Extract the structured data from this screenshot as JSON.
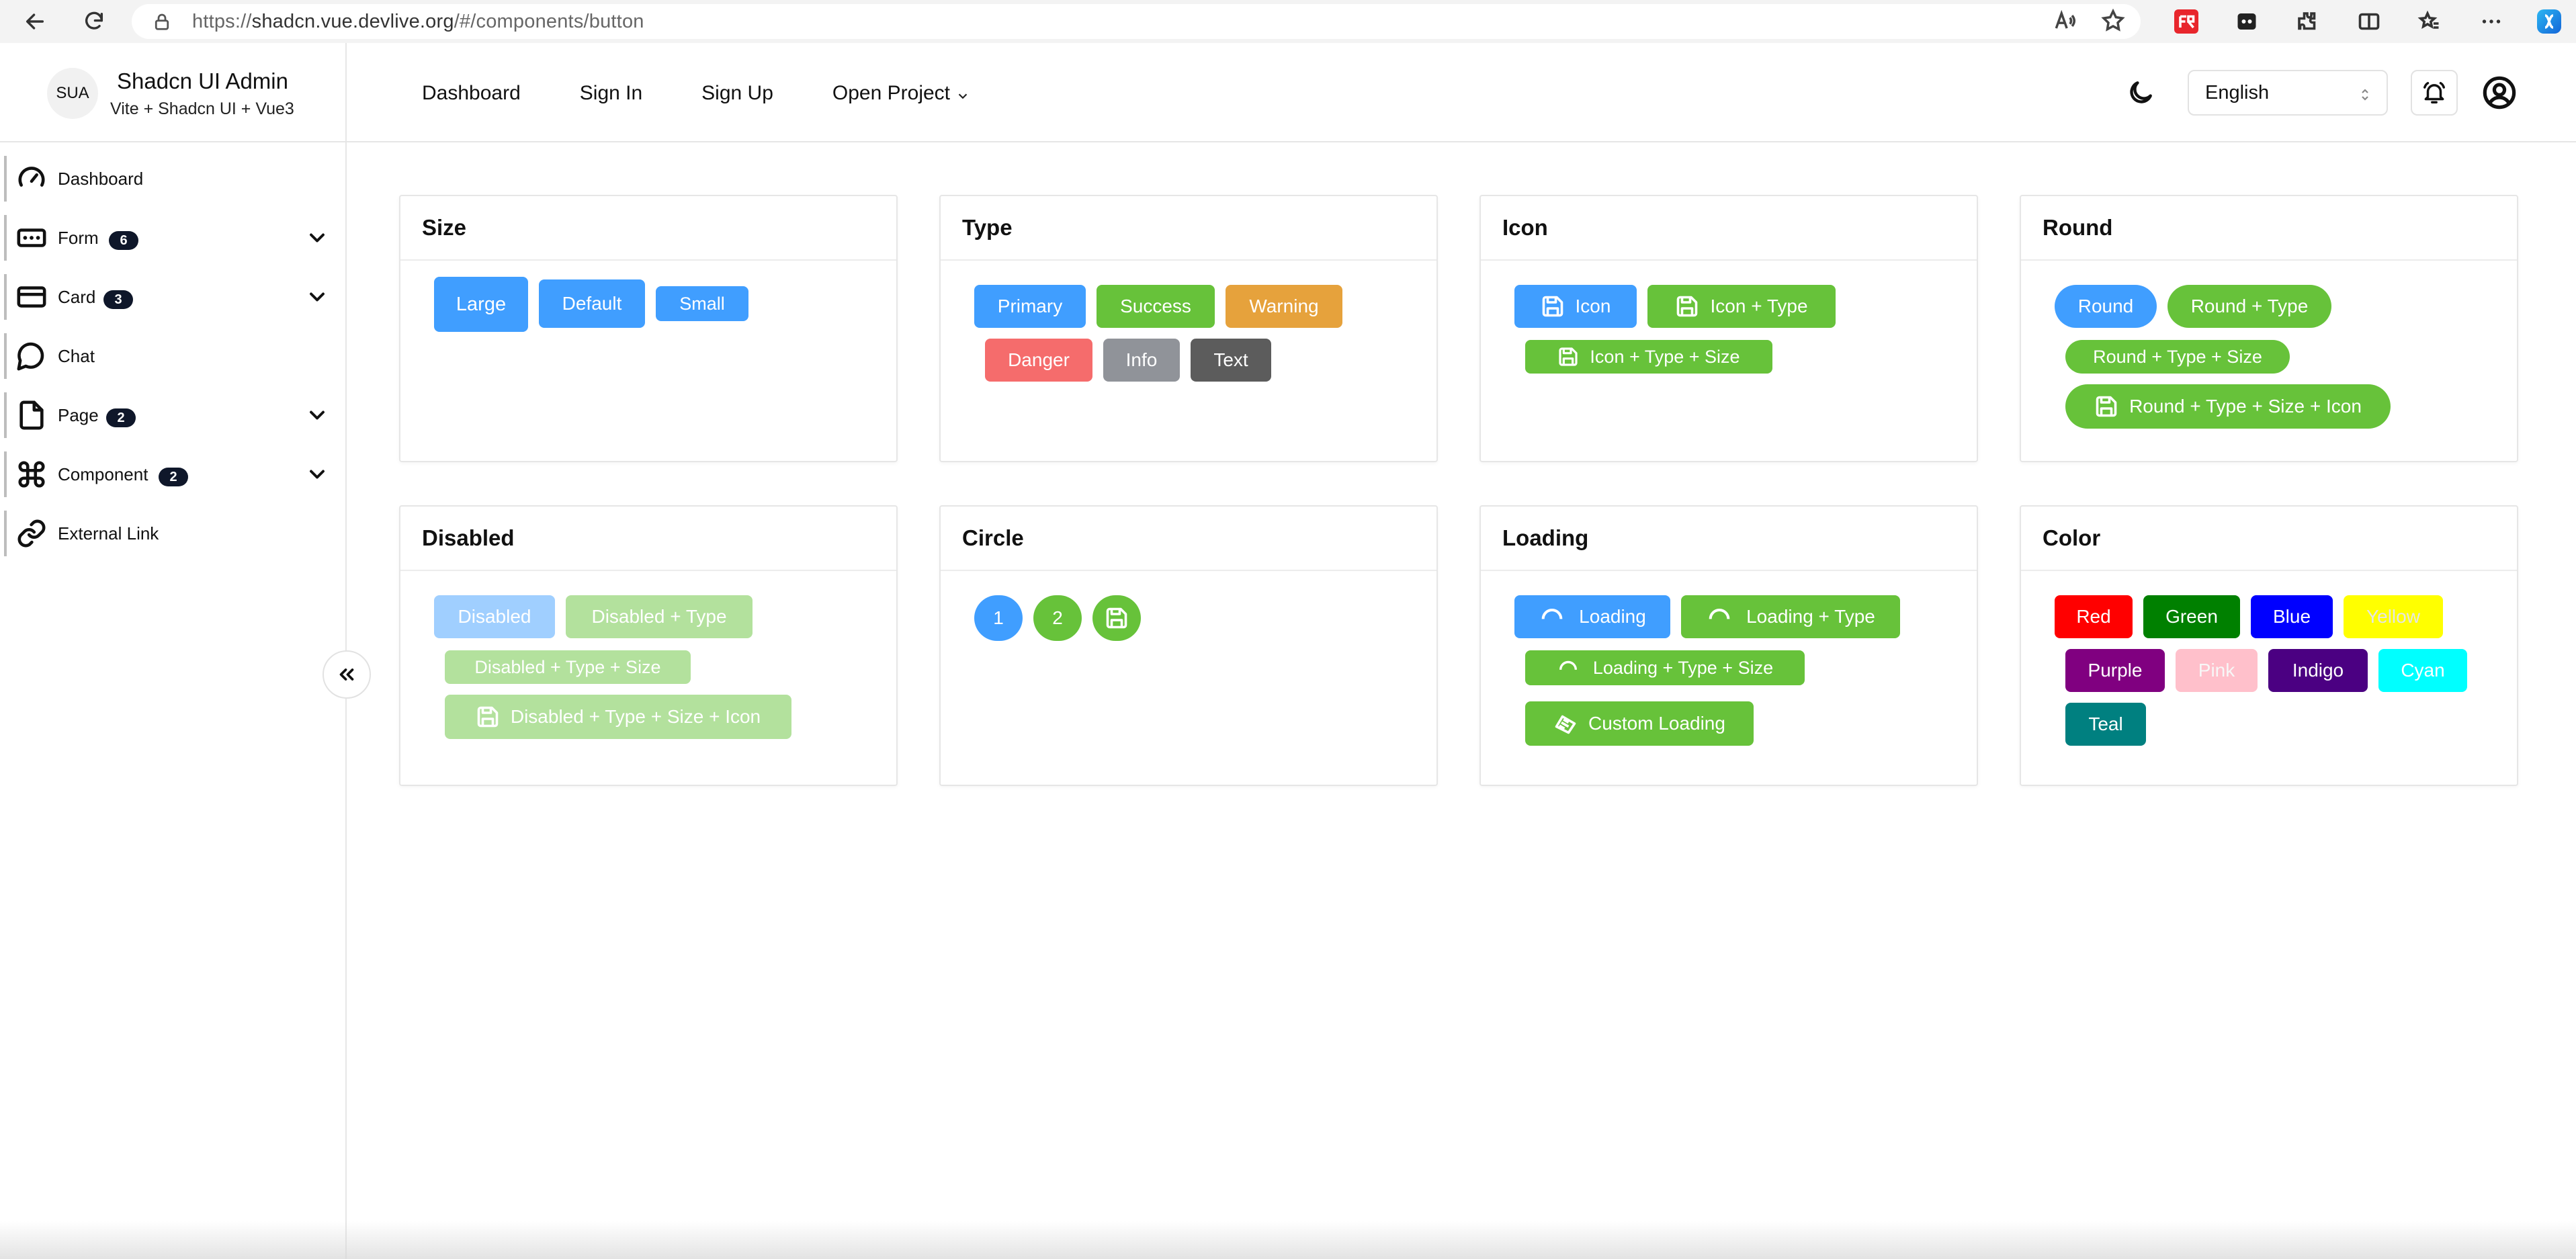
{
  "browser": {
    "url_prefix": "https://",
    "url_host": "shadcn.vue.devlive.org",
    "url_path": "/#/components/button"
  },
  "header": {
    "avatar_text": "SUA",
    "title": "Shadcn UI Admin",
    "subtitle": "Vite + Shadcn UI + Vue3",
    "nav": [
      {
        "label": "Dashboard"
      },
      {
        "label": "Sign In"
      },
      {
        "label": "Sign Up"
      },
      {
        "label": "Open Project"
      }
    ],
    "language": "English"
  },
  "sidebar": {
    "items": [
      {
        "label": "Dashboard",
        "icon": "gauge-icon"
      },
      {
        "label": "Form",
        "icon": "form-icon",
        "badge": "6"
      },
      {
        "label": "Card",
        "icon": "credit-card-icon",
        "badge": "3"
      },
      {
        "label": "Chat",
        "icon": "chat-bubble-icon"
      },
      {
        "label": "Page",
        "icon": "file-icon",
        "badge": "2"
      },
      {
        "label": "Component",
        "icon": "command-icon",
        "badge": "2"
      },
      {
        "label": "External Link",
        "icon": "link-icon"
      }
    ]
  },
  "cards": {
    "size": {
      "title": "Size",
      "buttons": [
        "Large",
        "Default",
        "Small"
      ]
    },
    "type": {
      "title": "Type",
      "buttons": [
        "Primary",
        "Success",
        "Warning",
        "Danger",
        "Info",
        "Text"
      ]
    },
    "icon": {
      "title": "Icon",
      "buttons": [
        "Icon",
        "Icon + Type",
        "Icon + Type + Size"
      ]
    },
    "round": {
      "title": "Round",
      "buttons": [
        "Round",
        "Round + Type",
        "Round + Type + Size",
        "Round + Type + Size + Icon"
      ]
    },
    "disabled": {
      "title": "Disabled",
      "buttons": [
        "Disabled",
        "Disabled + Type",
        "Disabled + Type + Size",
        "Disabled + Type + Size + Icon"
      ]
    },
    "circle": {
      "title": "Circle",
      "buttons": [
        "1",
        "2"
      ]
    },
    "loading": {
      "title": "Loading",
      "buttons": [
        "Loading",
        "Loading + Type",
        "Loading + Type + Size",
        "Custom Loading"
      ]
    },
    "color": {
      "title": "Color",
      "buttons": [
        {
          "label": "Red",
          "bg": "#ff0000",
          "fg": "#ffffff"
        },
        {
          "label": "Green",
          "bg": "#008000",
          "fg": "#ffffff"
        },
        {
          "label": "Blue",
          "bg": "#0000ff",
          "fg": "#ffffff"
        },
        {
          "label": "Yellow",
          "bg": "#ffff00",
          "fg": "#e5e5e5"
        },
        {
          "label": "Purple",
          "bg": "#800080",
          "fg": "#ffffff"
        },
        {
          "label": "Pink",
          "bg": "#ffc0cb",
          "fg": "#f7f7f7"
        },
        {
          "label": "Indigo",
          "bg": "#4b0082",
          "fg": "#ffffff"
        },
        {
          "label": "Cyan",
          "bg": "#00ffff",
          "fg": "#ffffff"
        },
        {
          "label": "Teal",
          "bg": "#008080",
          "fg": "#ffffff"
        }
      ]
    }
  }
}
